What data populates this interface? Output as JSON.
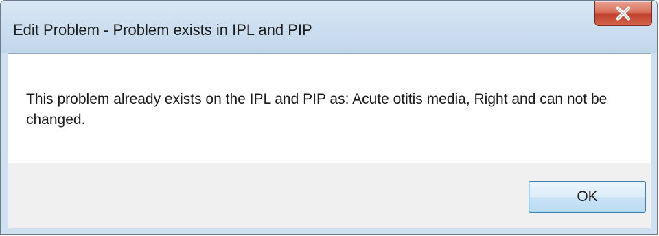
{
  "window": {
    "title": "Edit Problem - Problem exists in IPL and PIP"
  },
  "titlebar_buttons": {
    "close_icon": "close-icon",
    "close_glyph": "x"
  },
  "dialog": {
    "message": "This problem already exists on the IPL and PIP as: Acute otitis media, Right and can not be changed.",
    "ok_label": "OK"
  },
  "colors": {
    "titlebar": "#cddff0",
    "close_button": "#c0412a",
    "button_area": "#f0f0f0",
    "ok_border": "#3c7fb1"
  }
}
